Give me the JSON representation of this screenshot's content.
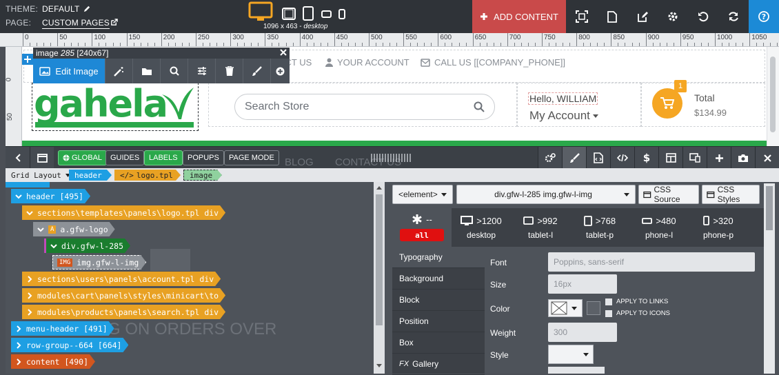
{
  "topbar": {
    "theme_label": "THEME:",
    "theme_value": "DEFAULT",
    "page_label": "PAGE:",
    "page_value": "CUSTOM PAGES",
    "viewport_size": "1096 x 463 -",
    "viewport_mode": "desktop",
    "add_content": "ADD CONTENT"
  },
  "ruler": {
    "marks": [
      "0",
      "50",
      "100",
      "150",
      "200",
      "250",
      "300",
      "350",
      "400",
      "450",
      "500",
      "550",
      "600",
      "650",
      "700",
      "750",
      "800",
      "850",
      "900",
      "950",
      "1000",
      "1050"
    ],
    "left_marks": [
      "0",
      "50"
    ]
  },
  "image_overlay": {
    "caption_prefix": "image",
    "caption_id": "285",
    "caption_size": "[240x67]",
    "edit_label": "Edit Image"
  },
  "site": {
    "logo_text": "gahela",
    "contact": "CONTACT US",
    "account": "YOUR ACCOUNT",
    "call": "CALL US [[COMPANY_PHONE]]",
    "search_placeholder": "Search Store",
    "hello": "Hello, WILLIAM",
    "my_account": "My Account",
    "cart_count": "1",
    "total_label": "Total",
    "total_value": "$134.99",
    "behind_blog": "BLOG",
    "behind_contact": "CONTACT US",
    "behind_promo": "ING ON ORDERS OVER"
  },
  "panel_toolbar": {
    "global": "GLOBAL",
    "guides": "GUIDES",
    "labels": "LABELS",
    "popups": "POPUPS",
    "page_mode": "PAGE MODE"
  },
  "crumb": {
    "layout": "Grid Layout",
    "header": "header",
    "logo": "logo.tpl",
    "image": "image"
  },
  "tree": [
    {
      "label": "header [495]"
    },
    {
      "label": "sections\\templates\\panels\\logo.tpl div"
    },
    {
      "label": "a.gfw-logo",
      "badge": "A"
    },
    {
      "label": "div.gfw-l-285"
    },
    {
      "label": "img.gfw-l-img",
      "badge": "IMG"
    },
    {
      "label": "sections\\users\\panels\\account.tpl div"
    },
    {
      "label": "modules\\cart\\panels\\styles\\minicart\\to"
    },
    {
      "label": "modules\\products\\panels\\search.tpl div"
    },
    {
      "label": "menu-header [491]"
    },
    {
      "label": "row-group--664 [664]"
    },
    {
      "label": "content [490]"
    }
  ],
  "props": {
    "element_select": "<element>",
    "selector": "div.gfw-l-285 img.gfw-l-img",
    "css_source": "CSS Source",
    "css_styles": "CSS Styles",
    "all_state": "--",
    "all_label": "all",
    "breakpoints": [
      {
        "size": ">1200",
        "name": "desktop"
      },
      {
        "size": ">992",
        "name": "tablet-l"
      },
      {
        "size": ">768",
        "name": "tablet-p"
      },
      {
        "size": ">480",
        "name": "phone-l"
      },
      {
        "size": ">320",
        "name": "phone-p"
      }
    ],
    "tabs": [
      "Typography",
      "Background",
      "Block",
      "Position",
      "Box",
      "Gallery"
    ],
    "tab_gallery_prefix": "FX",
    "font_label": "Font",
    "font_value": "Poppins, sans-serif",
    "size_label": "Size",
    "size_value": "16px",
    "color_label": "Color",
    "apply_links": "APPLY TO LINKS",
    "apply_icons": "APPLY TO ICONS",
    "weight_label": "Weight",
    "weight_value": "300",
    "style_label": "Style"
  },
  "colors": {
    "accent": "#1e88d6",
    "add_content": "#c94a4a",
    "brand_green": "#2aa84a",
    "cart_orange": "#f5a623"
  }
}
